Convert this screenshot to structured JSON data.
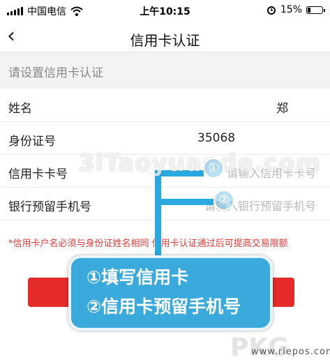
{
  "status": {
    "carrier": "中国电信",
    "time": "上午10:15",
    "battery": "15%"
  },
  "nav": {
    "back_glyph": "‹",
    "title": "信用卡认证"
  },
  "section": {
    "header": "请设置信用卡认证"
  },
  "form": {
    "name_label": "姓名",
    "name_value": "郑",
    "id_label": "身份证号",
    "id_value": "35068",
    "card_label": "信用卡卡号",
    "card_placeholder": "请输入信用卡卡号",
    "phone_label": "银行预留手机号",
    "phone_placeholder": "请输入银行预留手机号"
  },
  "notice": "*信用卡户名必须与身份证姓名相同 信用卡认证通过后可提高交易限额",
  "watermark": "3lTaoyuande.com",
  "callouts": {
    "one": "①",
    "two": "②"
  },
  "overlay": {
    "line1": "①填写信用卡",
    "line2": "②信用卡预留手机号"
  },
  "brand": {
    "logo_text": "PKG",
    "url": "www.riepos.com"
  },
  "colors": {
    "accent_red": "#e62b2b",
    "notice_red": "#e53935",
    "overlay_blue": "#3aa9dc"
  }
}
